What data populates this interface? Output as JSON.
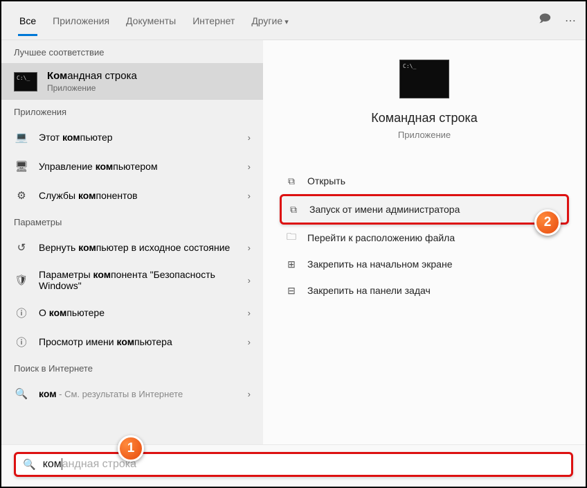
{
  "tabs": {
    "all": "Все",
    "apps": "Приложения",
    "docs": "Документы",
    "internet": "Интернет",
    "other": "Другие"
  },
  "sections": {
    "best": "Лучшее соответствие",
    "apps": "Приложения",
    "settings": "Параметры",
    "web": "Поиск в Интернете"
  },
  "best_match": {
    "title_prefix": "Ком",
    "title_rest": "андная строка",
    "sub": "Приложение"
  },
  "apps_list": [
    {
      "prefix": "Этот ",
      "bold": "ком",
      "rest": "пьютер",
      "icon": "💻"
    },
    {
      "prefix": "Управление ",
      "bold": "ком",
      "rest": "пьютером",
      "icon": "🖥"
    },
    {
      "prefix": "Службы ",
      "bold": "ком",
      "rest": "понентов",
      "icon": "⚙"
    }
  ],
  "settings_list": [
    {
      "prefix": "Вернуть ",
      "bold": "ком",
      "rest": "пьютер в исходное состояние",
      "icon": "↺"
    },
    {
      "prefix": "Параметры ",
      "bold": "ком",
      "rest": "понента \"Безопасность Windows\"",
      "icon": "🛡"
    },
    {
      "prefix": "О ",
      "bold": "ком",
      "rest": "пьютере",
      "icon": "ⓘ"
    },
    {
      "prefix": "Просмотр имени ",
      "bold": "ком",
      "rest": "пьютера",
      "icon": "ⓘ"
    }
  ],
  "web": {
    "bold": "ком",
    "sub": " - См. результаты в Интернете"
  },
  "preview": {
    "title": "Командная строка",
    "sub": "Приложение"
  },
  "actions": [
    {
      "label": "Открыть",
      "icon": "⧉"
    },
    {
      "label": "Запуск от имени администратора",
      "icon": "⧉",
      "highlight": true
    },
    {
      "label": "Перейти к расположению файла",
      "icon": "🗀"
    },
    {
      "label": "Закрепить на начальном экране",
      "icon": "⊞"
    },
    {
      "label": "Закрепить на панели задач",
      "icon": "⊟"
    }
  ],
  "search": {
    "typed": "ком",
    "placeholder_rest": "андная строка"
  },
  "badges": {
    "one": "1",
    "two": "2"
  }
}
